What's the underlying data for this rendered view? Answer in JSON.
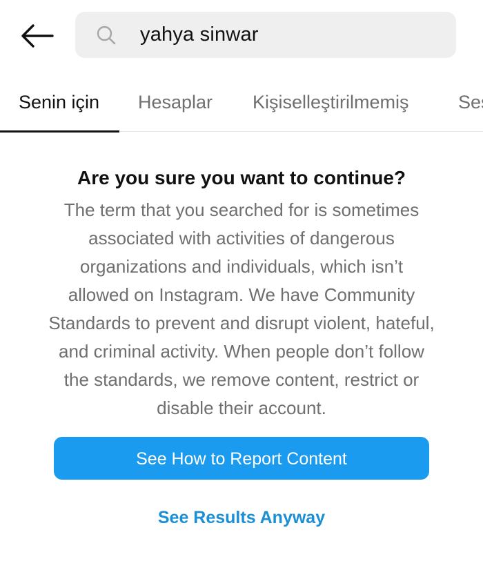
{
  "search": {
    "query": "yahya sinwar"
  },
  "tabs": [
    {
      "label": "Senin için",
      "active": true
    },
    {
      "label": "Hesaplar",
      "active": false
    },
    {
      "label": "Kişiselleştirilmemiş",
      "active": false
    },
    {
      "label": "Ses",
      "active": false
    }
  ],
  "warning": {
    "title": "Are you sure you want to continue?",
    "body": "The term that you searched for is sometimes associated with activities of dangerous organizations and individuals, which isn’t allowed on Instagram. We have Community Standards to prevent and disrupt violent, hateful, and criminal activity. When people don’t follow the standards, we remove content, restrict or disable their account."
  },
  "actions": {
    "primary_label": "See How to Report Content",
    "secondary_label": "See Results Anyway"
  },
  "icons": {
    "back": "arrow-left-icon",
    "search": "search-icon"
  },
  "colors": {
    "primary_button": "#1a9bef",
    "link": "#1b8fd6",
    "search_bg": "#efefef",
    "muted_text": "#6f6f6f"
  }
}
